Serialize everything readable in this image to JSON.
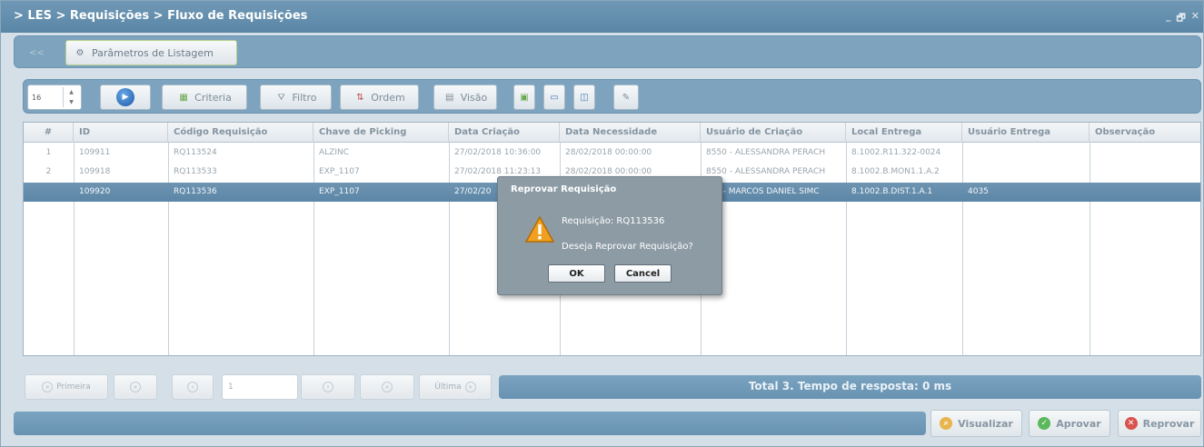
{
  "window": {
    "title": "> LES > Requisições > Fluxo de Requisições",
    "controls": [
      "_",
      "🗗",
      "✕"
    ]
  },
  "params": {
    "button_label": "Parâmetros de Listagem",
    "collapse_label": "<<"
  },
  "toolbar": {
    "page_size": "16",
    "criteria_label": "Criteria",
    "filtro_label": "Filtro",
    "ordem_label": "Ordem",
    "visao_label": "Visão"
  },
  "grid": {
    "columns": [
      "#",
      "ID",
      "Código Requisição",
      "Chave de Picking",
      "Data Criação",
      "Data Necessidade",
      "Usuário de Criação",
      "Local Entrega",
      "Usuário Entrega",
      "Observação"
    ],
    "rows": [
      [
        "1",
        "109911",
        "RQ113524",
        "ALZINC",
        "27/02/2018 10:36:00",
        "28/02/2018 00:00:00",
        "8550 - ALESSANDRA PERACH",
        "8.1002.R11.322-0024",
        "",
        ""
      ],
      [
        "2",
        "109918",
        "RQ113533",
        "EXP_1107",
        "27/02/2018 11:23:13",
        "28/02/2018 00:00:00",
        "8550 - ALESSANDRA PERACH",
        "8.1002.B.MON1.1.A.2",
        "",
        ""
      ],
      [
        "",
        "109920",
        "RQ113536",
        "EXP_1107",
        "27/02/20",
        "",
        "5 - MARCOS DANIEL SIMC",
        "8.1002.B.DIST.1.A.1",
        "4035",
        ""
      ]
    ],
    "selected_row": 2
  },
  "pager": {
    "first_label": "Primeira",
    "last_label": "Última",
    "page_value": "1",
    "status": "Total 3. Tempo de resposta: 0 ms"
  },
  "actions": {
    "visualizar": "Visualizar",
    "aprovar": "Aprovar",
    "reprovar": "Reprovar"
  },
  "dialog": {
    "title": "Reprovar Requisição",
    "line1": "Requisição:  RQ113536",
    "line2": "Deseja Reprovar Requisição?",
    "ok": "OK",
    "cancel": "Cancel"
  },
  "colors": {
    "title_bar": "#5f8aa9",
    "selected_row": "#6489a8",
    "dialog": "#8d9ba5",
    "warning": "#f0a020",
    "approve": "#5cb85c",
    "reject": "#d9534f"
  }
}
